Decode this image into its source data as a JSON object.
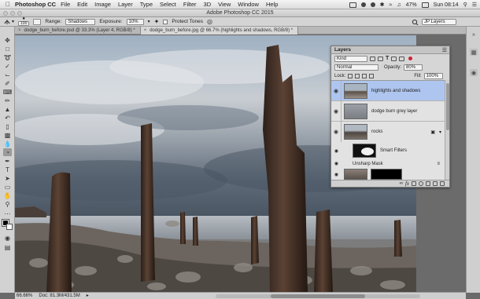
{
  "menubar": {
    "app_name": "Photoshop CC",
    "menus": [
      "File",
      "Edit",
      "Image",
      "Layer",
      "Type",
      "Select",
      "Filter",
      "3D",
      "View",
      "Window",
      "Help"
    ],
    "battery": "47%",
    "clock": "Sun 08:14"
  },
  "window": {
    "title": "Adobe Photoshop CC 2015"
  },
  "options": {
    "size_value": "100",
    "range_label": "Range:",
    "range_value": "Shadows",
    "exposure_label": "Exposure:",
    "exposure_value": "10%",
    "protect_tones_label": "Protect Tones",
    "workspace": "JP Layers"
  },
  "tabs": [
    {
      "label": "dodge_burn_before.psd @ 33.3% (Layer 4, RGB/8) *",
      "active": false
    },
    {
      "label": "dodge_burn_before.jpg @ 66.7% (highlights and shadows, RGB/8) *",
      "active": true
    }
  ],
  "layers_panel": {
    "title": "Layers",
    "filter_kind": "Kind",
    "blend_mode": "Normal",
    "opacity_label": "Opacity:",
    "opacity_value": "80%",
    "lock_label": "Lock:",
    "fill_label": "Fill:",
    "fill_value": "100%",
    "layers": [
      {
        "name": "highlights and shadows",
        "selected": true
      },
      {
        "name": "dodge burn grey layer",
        "selected": false
      },
      {
        "name": "rocks",
        "selected": false
      }
    ],
    "smart_filters_label": "Smart Filters",
    "unsharp_mask_label": "Unsharp Mask"
  },
  "status": {
    "zoom": "66.66%",
    "doc_size": "Doc: 81.3M/431.5M"
  }
}
